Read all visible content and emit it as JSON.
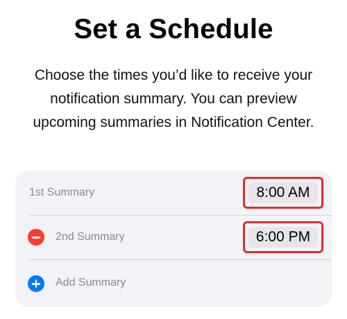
{
  "header": {
    "title": "Set a Schedule",
    "description": "Choose the times you’d like to receive your notification summary. You can preview upcoming summaries in Notification Center."
  },
  "schedule": {
    "rows": [
      {
        "label": "1st Summary",
        "time": "8:00 AM",
        "icon": ""
      },
      {
        "label": "2nd Summary",
        "time": "6:00 PM",
        "icon": "minus-circle-icon"
      }
    ],
    "add_label": "Add Summary",
    "add_icon": "plus-circle-icon"
  },
  "colors": {
    "highlight_border": "#e52b2b",
    "remove_icon": "#ff3b30",
    "add_icon": "#007aff",
    "card_background": "#f2f2f7",
    "time_pill_background": "#e5e5ea"
  }
}
